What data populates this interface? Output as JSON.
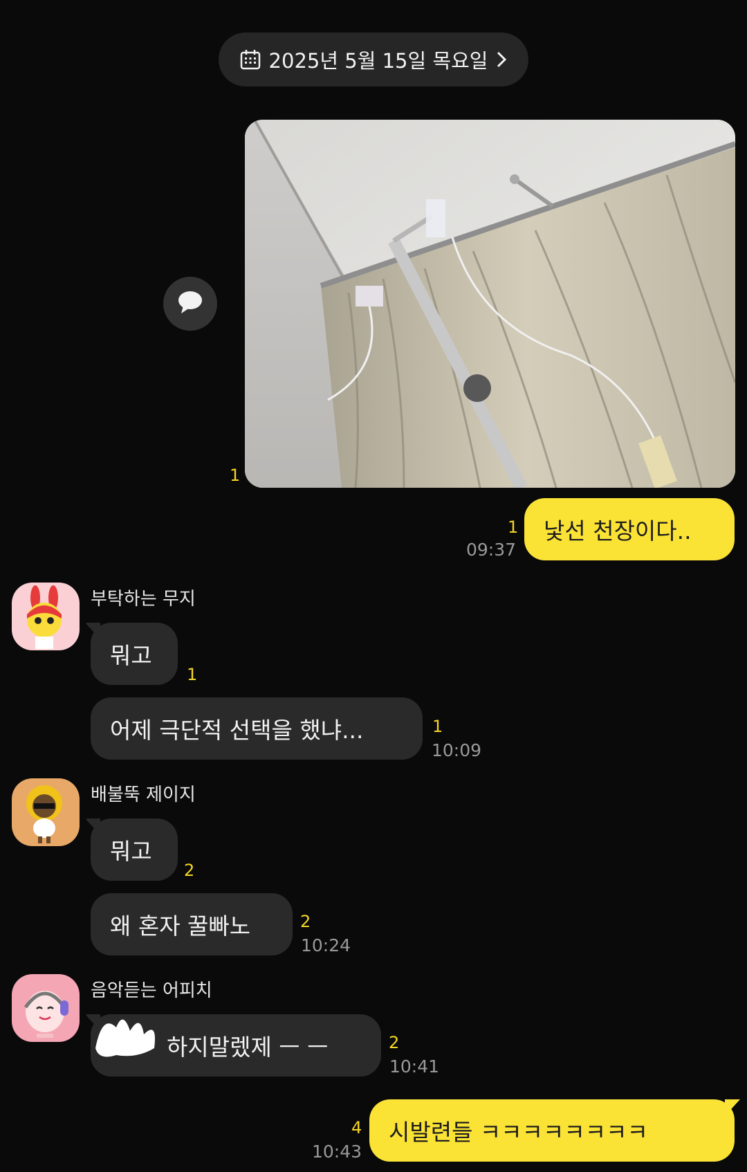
{
  "date_divider": {
    "label": "2025년 5월 15일 목요일",
    "icon": "calendar-icon",
    "chevron": ">"
  },
  "colors": {
    "background": "#0a0a0a",
    "my_bubble": "#fbe336",
    "other_bubble": "#2a2a2a",
    "unread": "#f5d626",
    "time": "#9a9a9a"
  },
  "photo_message": {
    "unread": "1",
    "share_icon": "speech-bubble-icon"
  },
  "messages": [
    {
      "unread": "1",
      "text": "낯선 천장이다..",
      "time": "09:37"
    },
    {
      "sender": "부탁하는 무지",
      "unread": "1",
      "text": "뭐고"
    },
    {
      "unread": "1",
      "text": "어제 극단적 선택을 했냐...",
      "time": "10:09"
    },
    {
      "sender": "배불뚝 제이지",
      "unread": "2",
      "text": "뭐고"
    },
    {
      "unread": "2",
      "text": "왜 혼자 꿀빠노",
      "time": "10:24"
    },
    {
      "sender": "음악듣는 어피치",
      "unread": "2",
      "text": "하지말렜제 ㅡ ㅡ",
      "time": "10:41"
    },
    {
      "unread": "4",
      "text": "시발련들 ㅋㅋㅋㅋㅋㅋㅋㅋ",
      "time": "10:43"
    }
  ]
}
